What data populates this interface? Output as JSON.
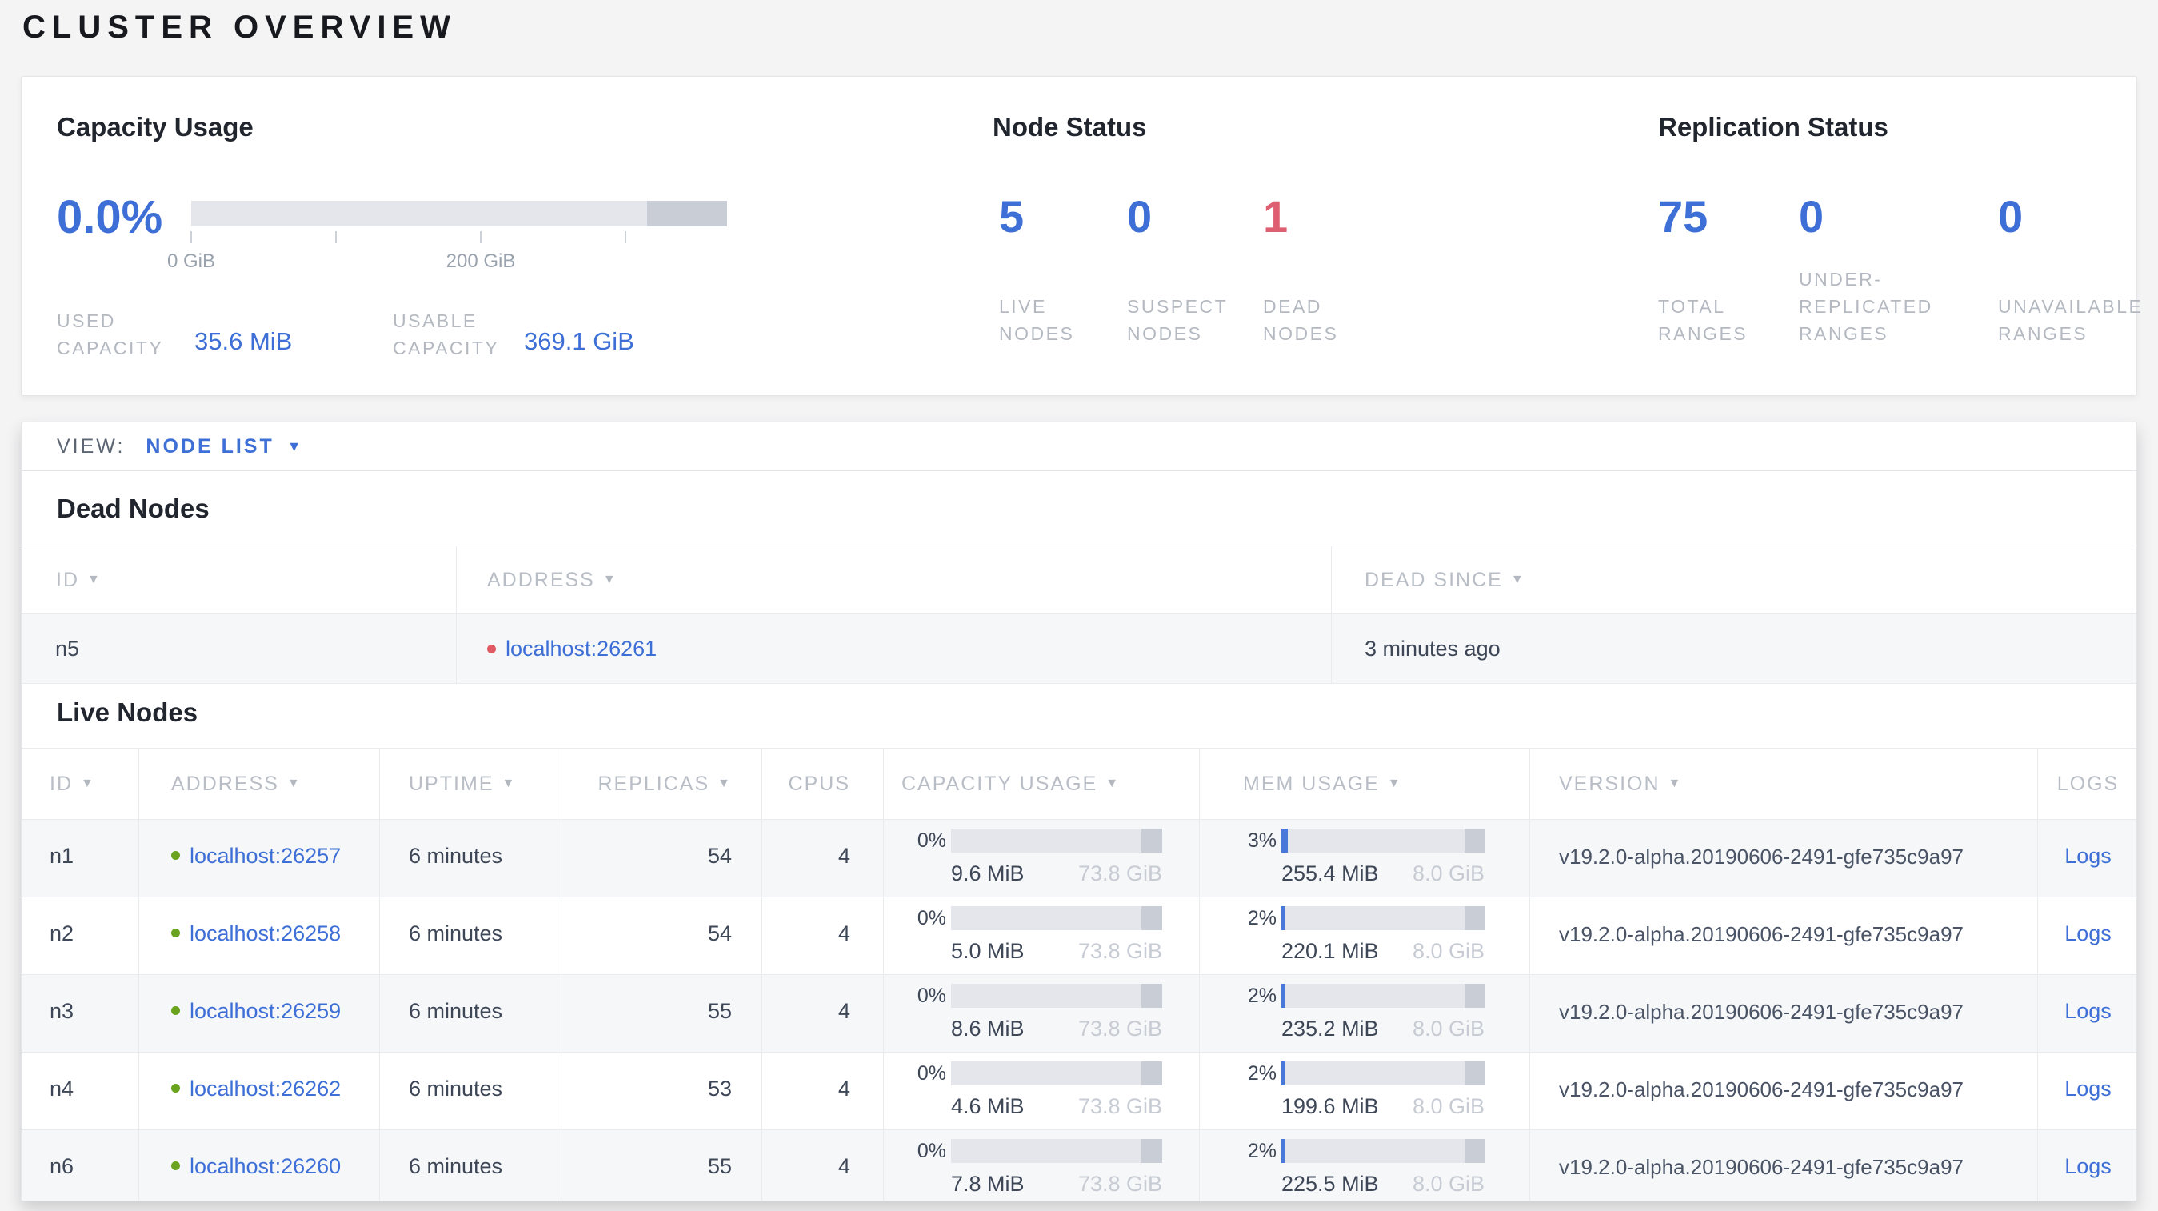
{
  "page_title": "CLUSTER OVERVIEW",
  "summary": {
    "capacity": {
      "title": "Capacity Usage",
      "percent": "0.0%",
      "bar": {
        "used_width": "0%",
        "reserved_width": "15%"
      },
      "tick_labels": [
        "0 GiB",
        "",
        "200 GiB",
        ""
      ],
      "used": {
        "label": "USED CAPACITY",
        "value": "35.6 MiB"
      },
      "usable": {
        "label": "USABLE CAPACITY",
        "value": "369.1 GiB"
      }
    },
    "node_status": {
      "title": "Node Status",
      "stats": [
        {
          "value": "5",
          "label": "LIVE NODES"
        },
        {
          "value": "0",
          "label": "SUSPECT NODES"
        },
        {
          "value": "1",
          "label": "DEAD NODES"
        }
      ]
    },
    "replication": {
      "title": "Replication Status",
      "stats": [
        {
          "value": "75",
          "label": "TOTAL RANGES"
        },
        {
          "value": "0",
          "label": "UNDER-REPLICATED RANGES"
        },
        {
          "value": "0",
          "label": "UNAVAILABLE RANGES"
        }
      ]
    }
  },
  "view_bar": {
    "label": "VIEW:",
    "selected": "NODE LIST"
  },
  "dead_nodes": {
    "title": "Dead Nodes",
    "columns": {
      "id": "ID",
      "address": "ADDRESS",
      "dead_since": "DEAD SINCE"
    },
    "rows": [
      {
        "id": "n5",
        "address": "localhost:26261",
        "dead_since": "3 minutes ago"
      }
    ]
  },
  "live_nodes": {
    "title": "Live Nodes",
    "columns": {
      "id": "ID",
      "address": "ADDRESS",
      "uptime": "UPTIME",
      "replicas": "REPLICAS",
      "cpus": "CPUS",
      "capacity": "CAPACITY USAGE",
      "mem": "MEM USAGE",
      "version": "VERSION",
      "logs": "LOGS"
    },
    "logs_label": "Logs",
    "bar_reserved_width": "10%",
    "rows": [
      {
        "id": "n1",
        "address": "localhost:26257",
        "uptime": "6 minutes",
        "replicas": "54",
        "cpus": "4",
        "capacity": {
          "percent": "0%",
          "used": "9.6 MiB",
          "total": "73.8 GiB"
        },
        "mem": {
          "percent": "3%",
          "used": "255.4 MiB",
          "total": "8.0 GiB"
        },
        "version": "v19.2.0-alpha.20190606-2491-gfe735c9a97"
      },
      {
        "id": "n2",
        "address": "localhost:26258",
        "uptime": "6 minutes",
        "replicas": "54",
        "cpus": "4",
        "capacity": {
          "percent": "0%",
          "used": "5.0 MiB",
          "total": "73.8 GiB"
        },
        "mem": {
          "percent": "2%",
          "used": "220.1 MiB",
          "total": "8.0 GiB"
        },
        "version": "v19.2.0-alpha.20190606-2491-gfe735c9a97"
      },
      {
        "id": "n3",
        "address": "localhost:26259",
        "uptime": "6 minutes",
        "replicas": "55",
        "cpus": "4",
        "capacity": {
          "percent": "0%",
          "used": "8.6 MiB",
          "total": "73.8 GiB"
        },
        "mem": {
          "percent": "2%",
          "used": "235.2 MiB",
          "total": "8.0 GiB"
        },
        "version": "v19.2.0-alpha.20190606-2491-gfe735c9a97"
      },
      {
        "id": "n4",
        "address": "localhost:26262",
        "uptime": "6 minutes",
        "replicas": "53",
        "cpus": "4",
        "capacity": {
          "percent": "0%",
          "used": "4.6 MiB",
          "total": "73.8 GiB"
        },
        "mem": {
          "percent": "2%",
          "used": "199.6 MiB",
          "total": "8.0 GiB"
        },
        "version": "v19.2.0-alpha.20190606-2491-gfe735c9a97"
      },
      {
        "id": "n6",
        "address": "localhost:26260",
        "uptime": "6 minutes",
        "replicas": "55",
        "cpus": "4",
        "capacity": {
          "percent": "0%",
          "used": "7.8 MiB",
          "total": "73.8 GiB"
        },
        "mem": {
          "percent": "2%",
          "used": "225.5 MiB",
          "total": "8.0 GiB"
        },
        "version": "v19.2.0-alpha.20190606-2491-gfe735c9a97"
      }
    ]
  },
  "colors": {
    "accent_blue": "#3e6fd6",
    "dead_red": "#de5f72",
    "live_green": "#6aa41f"
  }
}
